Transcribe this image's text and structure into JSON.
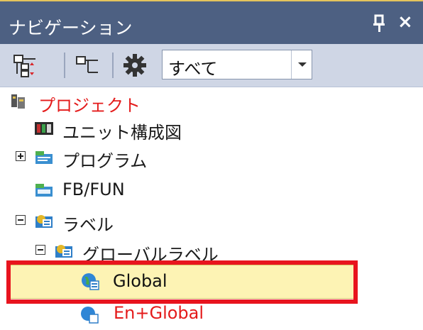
{
  "window": {
    "title": "ナビゲーション",
    "close_glyph": "×"
  },
  "toolbar": {
    "filter_value": "すべて"
  },
  "tree": {
    "project": "プロジェクト",
    "unit_config": "ユニット構成図",
    "program": "プログラム",
    "fb_fun": "FB/FUN",
    "label": "ラベル",
    "global_label": "グローバルラベル",
    "global": "Global",
    "en_global": "En+Global"
  },
  "colors": {
    "highlight": "#e8141e",
    "selection": "#fdf3b4",
    "red_text": "#e41b1b"
  }
}
